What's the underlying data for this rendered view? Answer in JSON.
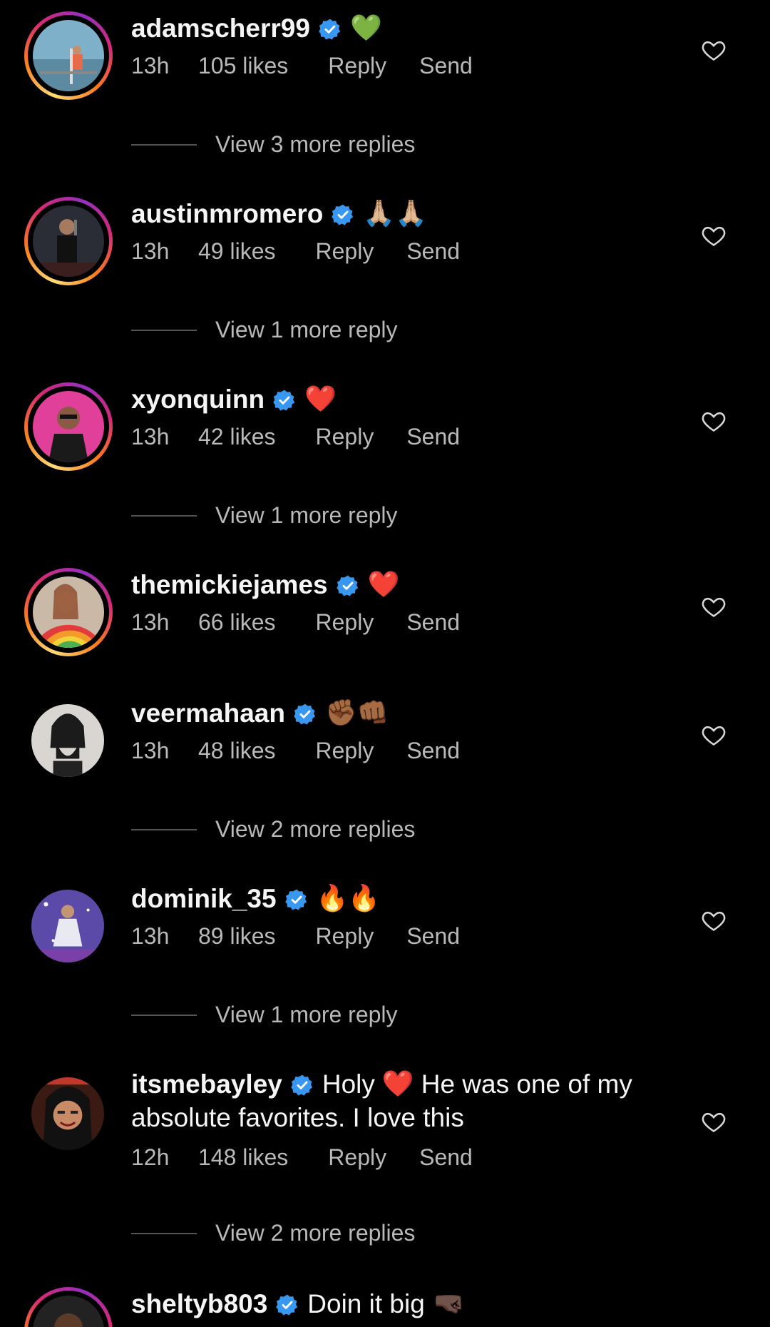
{
  "colors": {
    "background": "#000000",
    "verified": "#3897f0",
    "muted_text": "#b9b9b9",
    "story_ring": "#d62976"
  },
  "comments": [
    {
      "username": "adamscherr99",
      "text": "",
      "emoji": "💚",
      "emoji_name": "green-heart",
      "time": "13h",
      "likes": "105 likes",
      "reply": "Reply",
      "send": "Send",
      "view_replies": "View 3 more replies",
      "avatar_icon": "avatar-adamscherr99"
    },
    {
      "username": "austinmromero",
      "text": "",
      "emoji": "🙏🏼🙏🏼",
      "emoji_name": "praying-hands",
      "time": "13h",
      "likes": "49 likes",
      "reply": "Reply",
      "send": "Send",
      "view_replies": "View 1 more reply",
      "avatar_icon": "avatar-austinmromero"
    },
    {
      "username": "xyonquinn",
      "text": "",
      "emoji": "❤️",
      "emoji_name": "red-heart",
      "time": "13h",
      "likes": "42 likes",
      "reply": "Reply",
      "send": "Send",
      "view_replies": "View 1 more reply",
      "avatar_icon": "avatar-xyonquinn"
    },
    {
      "username": "themickiejames",
      "text": "",
      "emoji": "❤️",
      "emoji_name": "red-heart",
      "time": "13h",
      "likes": "66 likes",
      "reply": "Reply",
      "send": "Send",
      "view_replies": "",
      "avatar_icon": "avatar-themickiejames"
    },
    {
      "username": "veermahaan",
      "text": "",
      "emoji": "✊🏾👊🏾",
      "emoji_name": "raised-fist-punch",
      "time": "13h",
      "likes": "48 likes",
      "reply": "Reply",
      "send": "Send",
      "view_replies": "View 2 more replies",
      "avatar_icon": "avatar-veermahaan"
    },
    {
      "username": "dominik_35",
      "text": "",
      "emoji": "🔥🔥",
      "emoji_name": "fire",
      "time": "13h",
      "likes": "89 likes",
      "reply": "Reply",
      "send": "Send",
      "view_replies": "View 1 more reply",
      "avatar_icon": "avatar-dominik_35"
    },
    {
      "username": "itsmebayley",
      "text_before": "Holy",
      "emoji": "❤️",
      "emoji_name": "red-heart",
      "text_after": "He was one of my",
      "text_line2": "absolute favorites. I love this",
      "time": "12h",
      "likes": "148 likes",
      "reply": "Reply",
      "send": "Send",
      "view_replies": "View 2 more replies",
      "avatar_icon": "avatar-itsmebayley"
    },
    {
      "username": "sheltyb803",
      "text": "Doin it big",
      "emoji": "🤜🏿",
      "emoji_name": "right-fist",
      "avatar_icon": "avatar-sheltyb803"
    }
  ]
}
